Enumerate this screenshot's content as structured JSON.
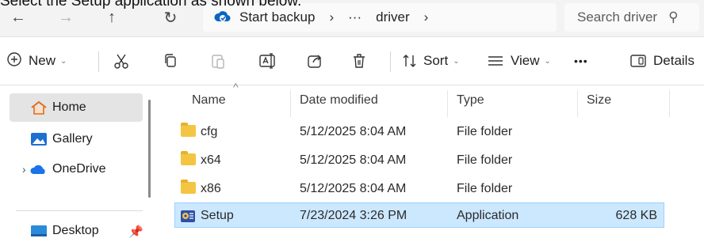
{
  "caption": "Select the Setup application as shown below.",
  "nav": {
    "back": "←",
    "forward": "→",
    "up": "↑",
    "refresh": "↻"
  },
  "address": {
    "segment1": "Start backup",
    "chevron": "›",
    "overflow": "···",
    "segment2": "driver"
  },
  "search": {
    "placeholder": "Search driver",
    "icon": "⚲"
  },
  "toolbar": {
    "new_label": "New",
    "sort_label": "Sort",
    "view_label": "View",
    "more": "•••",
    "details_label": "Details",
    "dropdown": "⌄"
  },
  "sidebar": {
    "items": [
      {
        "label": "Home",
        "icon": "home-icon",
        "active": true
      },
      {
        "label": "Gallery",
        "icon": "gallery-icon"
      },
      {
        "label": "OneDrive",
        "icon": "onedrive-icon"
      },
      {
        "label": "Desktop",
        "icon": "desktop-icon"
      }
    ],
    "expand": "›",
    "pin": "📌"
  },
  "columns": {
    "name": "Name",
    "date": "Date modified",
    "type": "Type",
    "size": "Size"
  },
  "files": [
    {
      "name": "cfg",
      "date": "5/12/2025 8:04 AM",
      "type": "File folder",
      "size": "",
      "icon": "folder-icon"
    },
    {
      "name": "x64",
      "date": "5/12/2025 8:04 AM",
      "type": "File folder",
      "size": "",
      "icon": "folder-icon"
    },
    {
      "name": "x86",
      "date": "5/12/2025 8:04 AM",
      "type": "File folder",
      "size": "",
      "icon": "folder-icon"
    },
    {
      "name": "Setup",
      "date": "7/23/2024 3:26 PM",
      "type": "Application",
      "size": "628 KB",
      "icon": "setup-app-icon",
      "selected": true
    }
  ],
  "colors": {
    "selection_bg": "#cce8ff",
    "selection_border": "#99d1ff",
    "accent": "#0067c0",
    "folder": "#f4c542"
  }
}
